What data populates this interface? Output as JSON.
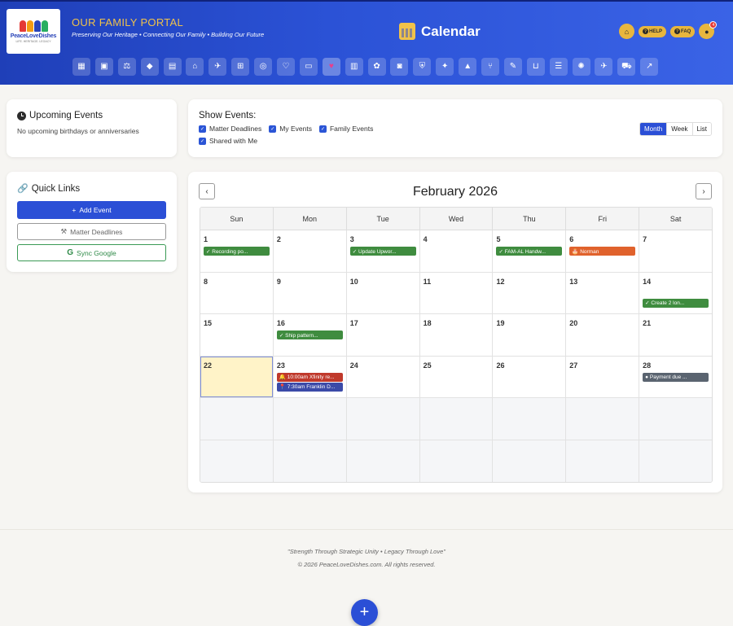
{
  "header": {
    "logo_text": "PeaceLoveDishes",
    "logo_sub": "LIFE. HERITAGE. LEGACY",
    "portal_title": "OUR FAMILY PORTAL",
    "tagline": "Preserving Our Heritage • Connecting Our Family • Building Our Future",
    "page_title": "Calendar",
    "help_label": "HELP",
    "faq_label": "FAQ",
    "notification_count": "4",
    "nav_icons": [
      "calendar-icon",
      "briefcase-icon",
      "scale-icon",
      "diamond-icon",
      "contact-book-icon",
      "home-icon",
      "bird-icon",
      "sitemap-icon",
      "target-icon",
      "heartbeat-icon",
      "book-icon",
      "heart-icon",
      "id-card-icon",
      "paw-icon",
      "camera-icon",
      "shield-icon",
      "lightbulb-icon",
      "warning-icon",
      "utensils-icon",
      "wrench-icon",
      "cart-icon",
      "checklist-icon",
      "brain-icon",
      "plane-icon",
      "car-icon",
      "chart-icon"
    ]
  },
  "upcoming": {
    "title": "Upcoming Events",
    "empty_text": "No upcoming birthdays or anniversaries"
  },
  "quick_links": {
    "title": "Quick Links",
    "add_event": "Add Event",
    "matter_deadlines": "Matter Deadlines",
    "sync_google": "Sync Google"
  },
  "filters": {
    "title": "Show Events:",
    "options": [
      "Matter Deadlines",
      "My Events",
      "Family Events",
      "Shared with Me"
    ],
    "views": [
      "Month",
      "Week",
      "List"
    ],
    "active_view": "Month"
  },
  "calendar": {
    "month_title": "February 2026",
    "weekdays": [
      "Sun",
      "Mon",
      "Tue",
      "Wed",
      "Thu",
      "Fri",
      "Sat"
    ],
    "today": "22",
    "weeks": [
      [
        {
          "d": "1",
          "ev": [
            {
              "t": "✓ Recording po...",
              "c": "green",
              "row": 0
            }
          ]
        },
        {
          "d": "2"
        },
        {
          "d": "3",
          "ev": [
            {
              "t": "✓ Update Upwor...",
              "c": "green",
              "row": 0
            }
          ]
        },
        {
          "d": "4"
        },
        {
          "d": "5",
          "ev": [
            {
              "t": "✓ FAM-AL Handw...",
              "c": "green",
              "row": 0
            }
          ]
        },
        {
          "d": "6",
          "ev": [
            {
              "t": "🎂 Norman",
              "c": "orange",
              "row": 0
            }
          ]
        },
        {
          "d": "7"
        }
      ],
      [
        {
          "d": "8"
        },
        {
          "d": "9"
        },
        {
          "d": "10"
        },
        {
          "d": "11"
        },
        {
          "d": "12"
        },
        {
          "d": "13"
        },
        {
          "d": "14",
          "ev": [
            {
              "t": "✓ Create 2 lon...",
              "c": "green",
              "row": 1
            }
          ]
        }
      ],
      [
        {
          "d": "15"
        },
        {
          "d": "16",
          "ev": [
            {
              "t": "✓ Ship pattern...",
              "c": "green",
              "row": 0
            }
          ]
        },
        {
          "d": "17"
        },
        {
          "d": "18"
        },
        {
          "d": "19"
        },
        {
          "d": "20"
        },
        {
          "d": "21"
        }
      ],
      [
        {
          "d": "22"
        },
        {
          "d": "23",
          "ev": [
            {
              "t": "🔔 10:00am Xfinity re...",
              "c": "red",
              "row": 0
            },
            {
              "t": "📍 7:30am Franklin D...",
              "c": "navy",
              "row": 1
            }
          ]
        },
        {
          "d": "24"
        },
        {
          "d": "25"
        },
        {
          "d": "26"
        },
        {
          "d": "27"
        },
        {
          "d": "28",
          "ev": [
            {
              "t": "● Payment due ...",
              "c": "gray",
              "row": 0
            }
          ]
        }
      ],
      [
        {
          "d": ""
        },
        {
          "d": ""
        },
        {
          "d": ""
        },
        {
          "d": ""
        },
        {
          "d": ""
        },
        {
          "d": ""
        },
        {
          "d": ""
        }
      ],
      [
        {
          "d": ""
        },
        {
          "d": ""
        },
        {
          "d": ""
        },
        {
          "d": ""
        },
        {
          "d": ""
        },
        {
          "d": ""
        },
        {
          "d": ""
        }
      ]
    ]
  },
  "footer": {
    "quote": "\"Strength Through Strategic Unity • Legacy Through Love\"",
    "copyright": "© 2026 PeaceLoveDishes.com. All rights reserved."
  }
}
